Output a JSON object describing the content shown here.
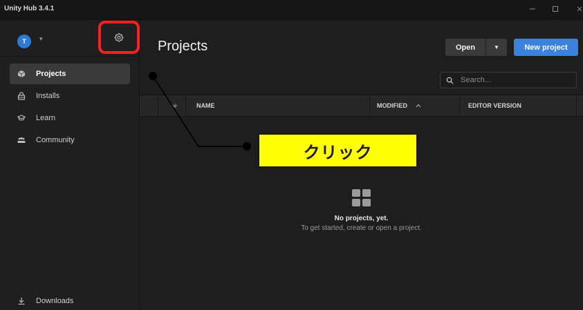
{
  "window": {
    "title": "Unity Hub 3.4.1",
    "controls": [
      "minimize-icon",
      "maximize-icon",
      "close-icon"
    ]
  },
  "sidebar": {
    "avatar_initial": "T",
    "items": [
      {
        "label": "Projects",
        "icon": "cube-icon",
        "active": true
      },
      {
        "label": "Installs",
        "icon": "lock-icon",
        "active": false
      },
      {
        "label": "Learn",
        "icon": "graduation-cap-icon",
        "active": false
      },
      {
        "label": "Community",
        "icon": "people-icon",
        "active": false
      }
    ],
    "downloads_label": "Downloads"
  },
  "main": {
    "title": "Projects",
    "open_label": "Open",
    "new_project_label": "New project",
    "search_placeholder": "Search...",
    "columns": {
      "name": "NAME",
      "modified": "MODIFIED",
      "editor_version": "EDITOR VERSION"
    },
    "empty_title": "No projects, yet.",
    "empty_subtitle": "To get started, create or open a project."
  },
  "annotation": {
    "label": "クリック",
    "highlight_color": "#ff1f1f",
    "box_color": "#ffff00"
  },
  "colors": {
    "accent": "#3b82dc",
    "background": "#1e1e1e",
    "sidebar": "#1f1f1f"
  }
}
